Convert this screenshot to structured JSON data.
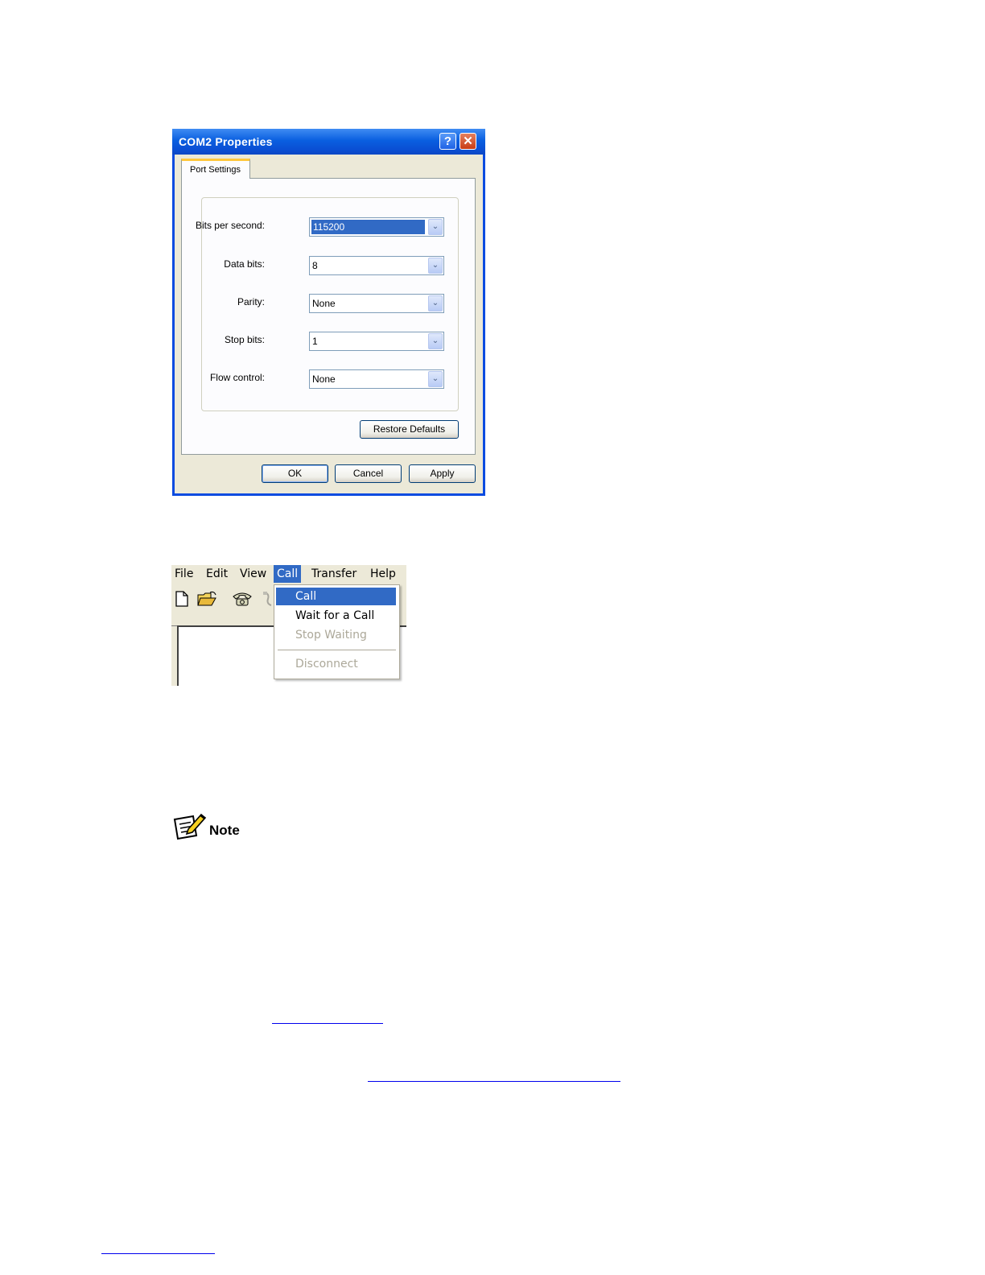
{
  "dialog": {
    "title": "COM2 Properties",
    "help_glyph": "?",
    "close_glyph": "✕",
    "tab_label": "Port Settings",
    "fields": [
      {
        "label": "Bits per second:",
        "value": "115200",
        "selected": true
      },
      {
        "label": "Data bits:",
        "value": "8"
      },
      {
        "label": "Parity:",
        "value": "None"
      },
      {
        "label": "Stop bits:",
        "value": "1"
      },
      {
        "label": "Flow control:",
        "value": "None"
      }
    ],
    "restore_label": "Restore Defaults",
    "ok_label": "OK",
    "cancel_label": "Cancel",
    "apply_label": "Apply",
    "colors": {
      "titlebar": "#0a5fe0",
      "selection": "#316ac5",
      "face": "#ece9d8"
    }
  },
  "hyperterminal": {
    "menu": [
      "File",
      "Edit",
      "View",
      "Call",
      "Transfer",
      "Help"
    ],
    "active_menu": "Call",
    "toolbar_icons": [
      "new-file-icon",
      "open-folder-icon",
      "phone-icon",
      "disconnect-icon"
    ],
    "call_menu": [
      {
        "label": "Call",
        "highlighted": true
      },
      {
        "label": "Wait for a Call"
      },
      {
        "label": "Stop Waiting",
        "disabled": true
      },
      {
        "label": "Disconnect",
        "disabled": true
      }
    ]
  },
  "note": {
    "label": "Note",
    "icon": "note-pencil-icon"
  }
}
